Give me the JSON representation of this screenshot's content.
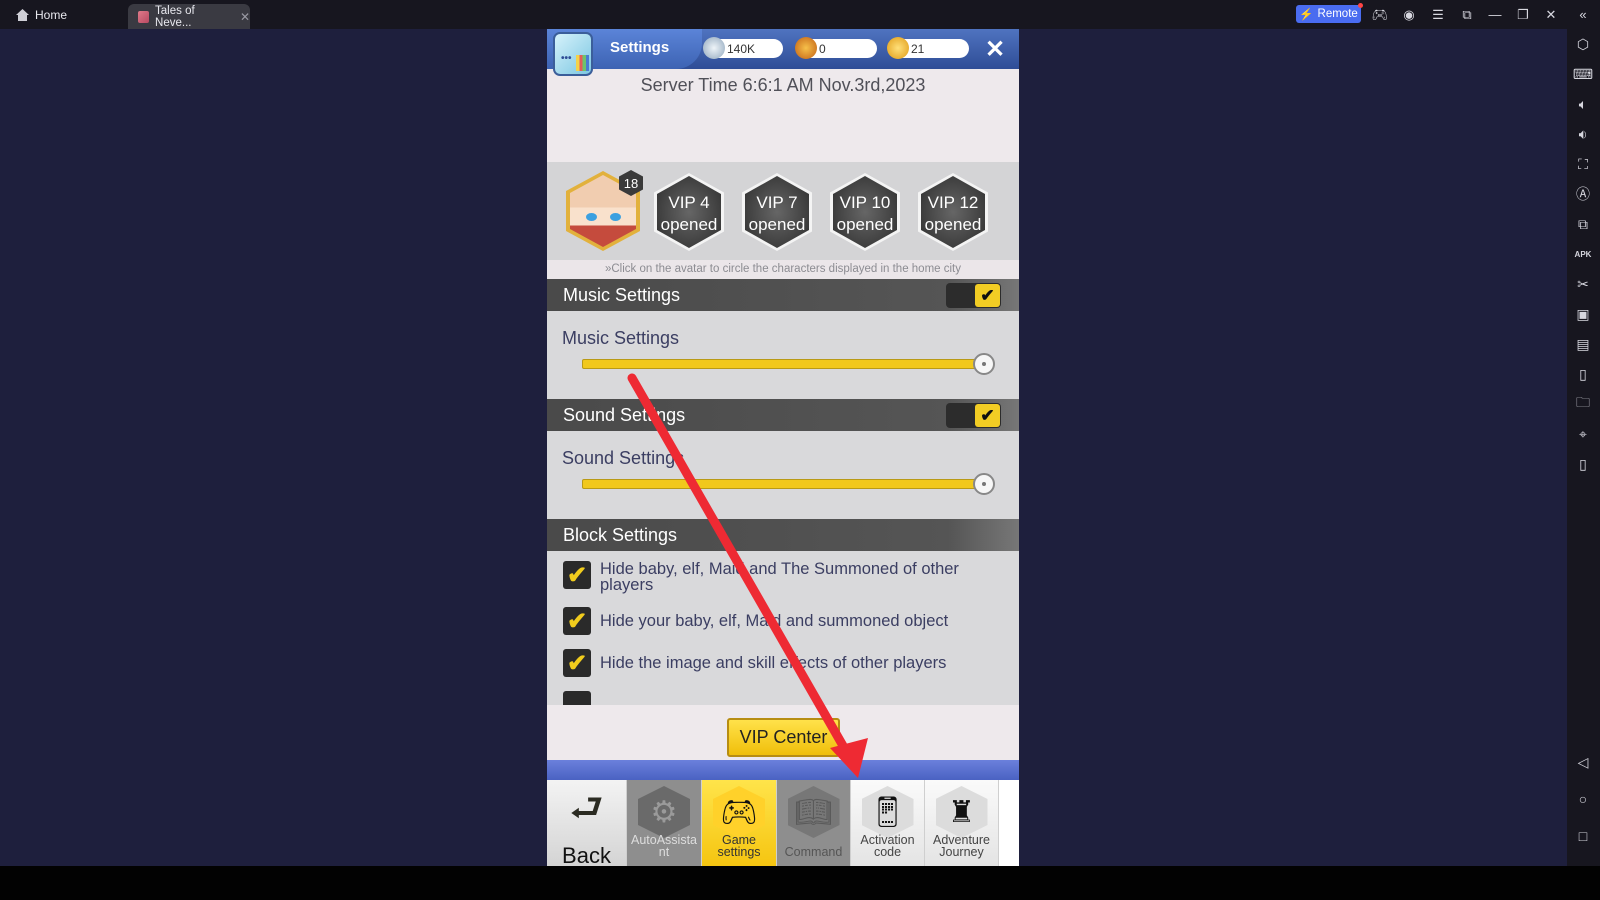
{
  "window": {
    "tabs": [
      {
        "label": "Home",
        "icon": "home-icon",
        "active": false
      },
      {
        "label": "Tales of Neve...",
        "icon": "game-thumbnail-icon",
        "active": true
      }
    ],
    "remote_label": "Remote",
    "controls": [
      "gamepad-icon",
      "account-icon",
      "menu-icon",
      "resize-icon",
      "minimize-icon",
      "restore-icon",
      "close-icon",
      "collapse-sidebar-icon"
    ]
  },
  "sidebar": {
    "icons": [
      "settings-hex-icon",
      "keyboard-icon",
      "volume-up-icon",
      "volume-down-icon",
      "screenshot-frame-icon",
      "auto-rotate-icon",
      "add-window-icon",
      "apk-install-icon",
      "scissors-icon",
      "media-icon",
      "notes-icon",
      "shake-icon",
      "folder-icon",
      "location-icon",
      "rotate-device-icon"
    ],
    "android_nav": [
      "back-icon",
      "home-circle-icon",
      "recents-square-icon"
    ]
  },
  "game": {
    "header": {
      "title": "Settings",
      "resources": [
        {
          "name": "diamond",
          "value": "140K",
          "color": "#9fb4c8"
        },
        {
          "name": "medal",
          "value": "0",
          "color": "#e07b22"
        },
        {
          "name": "gold",
          "value": "21",
          "color": "#f0b428"
        }
      ],
      "close": "✕"
    },
    "server_time": "Server Time 6:6:1 AM Nov.3rd,2023",
    "avatar": {
      "level": "18"
    },
    "vip_badges": [
      {
        "line1": "VIP 4",
        "line2": "opened"
      },
      {
        "line1": "VIP 7",
        "line2": "opened"
      },
      {
        "line1": "VIP 10",
        "line2": "opened"
      },
      {
        "line1": "VIP 12",
        "line2": "opened"
      }
    ],
    "hint": "»Click on the avatar to circle the characters displayed in the home city",
    "music": {
      "header": "Music Settings",
      "enabled": true,
      "slider_label": "Music Settings",
      "volume_percent": 100
    },
    "sound": {
      "header": "Sound Settings",
      "enabled": true,
      "slider_label": "Sound Settings",
      "volume_percent": 100
    },
    "block": {
      "header": "Block Settings",
      "options": [
        {
          "label": "Hide baby, elf, Maid and The Summoned of other players",
          "checked": true
        },
        {
          "label": "Hide your baby, elf, Maid and summoned object",
          "checked": true
        },
        {
          "label": "Hide the image and skill effects of other players",
          "checked": true
        }
      ]
    },
    "vip_center": "VIP Center",
    "nav": [
      {
        "label": "Back",
        "icon": "back-arrow-icon"
      },
      {
        "label": "AutoAssista nt",
        "icon": "gamepad-gear-icon"
      },
      {
        "label": "Game settings",
        "icon": "game-settings-icon",
        "active": true
      },
      {
        "label": "Command",
        "icon": "book-icon"
      },
      {
        "label": "Activation code",
        "icon": "phone-chat-icon"
      },
      {
        "label": "Adventure Journey",
        "icon": "castle-icon"
      }
    ],
    "checkmark": "✔"
  },
  "colors": {
    "accent_yellow": "#f1c81c",
    "annotation_red": "#ee2a33",
    "header_blue": "#3d63b3"
  }
}
